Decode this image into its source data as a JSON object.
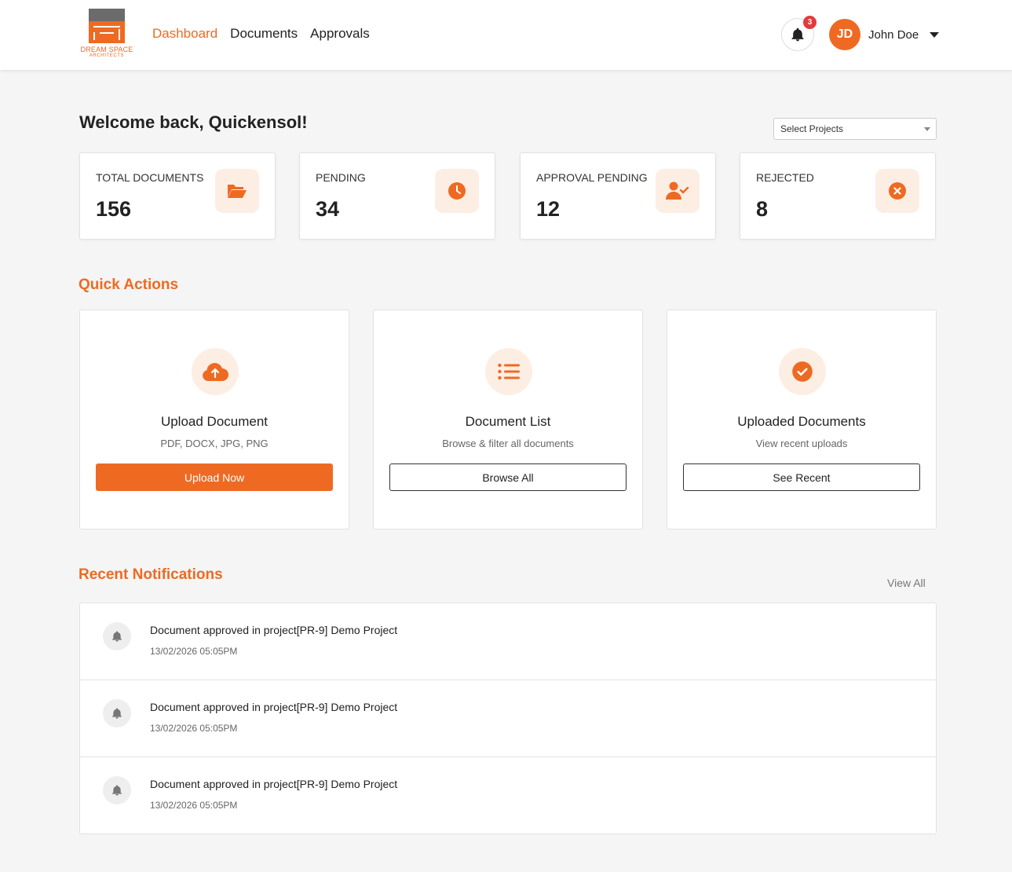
{
  "brand": {
    "name": "DREAM SPACE",
    "sub": "ARCHITECTS"
  },
  "nav": {
    "dashboard": "Dashboard",
    "documents": "Documents",
    "approvals": "Approvals"
  },
  "header": {
    "notification_count": "3",
    "avatar_initials": "JD",
    "user_name": "John Doe"
  },
  "welcome": {
    "title": "Welcome back, Quickensol!",
    "project_select": "Select Projects"
  },
  "stats": [
    {
      "label": "TOTAL DOCUMENTS",
      "value": "156",
      "icon": "folder-open-icon"
    },
    {
      "label": "PENDING",
      "value": "34",
      "icon": "clock-icon"
    },
    {
      "label": "APPROVAL PENDING",
      "value": "12",
      "icon": "user-check-icon"
    },
    {
      "label": "REJECTED",
      "value": "8",
      "icon": "x-circle-icon"
    }
  ],
  "quick_actions": {
    "title": "Quick Actions",
    "cards": [
      {
        "title": "Upload Document",
        "desc": "PDF, DOCX, JPG, PNG",
        "button": "Upload Now",
        "icon": "cloud-upload-icon"
      },
      {
        "title": "Document List",
        "desc": "Browse & filter all documents",
        "button": "Browse All",
        "icon": "list-icon"
      },
      {
        "title": "Uploaded Documents",
        "desc": "View recent uploads",
        "button": "See Recent",
        "icon": "check-circle-icon"
      }
    ]
  },
  "notifications": {
    "title": "Recent Notifications",
    "view_all": "View All",
    "items": [
      {
        "message": "Document approved in project[PR-9] Demo Project",
        "time": "13/02/2026 05:05PM"
      },
      {
        "message": "Document approved in project[PR-9] Demo Project",
        "time": "13/02/2026 05:05PM"
      },
      {
        "message": "Document approved in project[PR-9] Demo Project",
        "time": "13/02/2026 05:05PM"
      }
    ]
  },
  "colors": {
    "accent": "#ee6a22",
    "accent_light": "#fdeee4",
    "badge": "#e23b3b",
    "background": "#f5f5f5"
  }
}
